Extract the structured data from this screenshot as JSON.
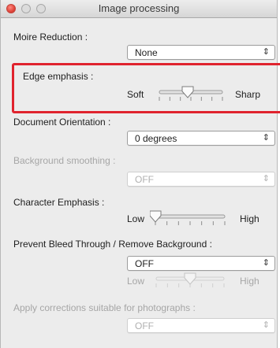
{
  "window": {
    "title": "Image processing"
  },
  "moire": {
    "label": "Moire Reduction :",
    "value": "None"
  },
  "edge": {
    "label": "Edge emphasis :",
    "min_label": "Soft",
    "max_label": "Sharp",
    "level": 0.45
  },
  "orientation": {
    "label": "Document Orientation :",
    "value": "0 degrees"
  },
  "background_smoothing": {
    "label": "Background smoothing :",
    "value": "OFF"
  },
  "character_emphasis": {
    "label": "Character Emphasis :",
    "min_label": "Low",
    "max_label": "High",
    "level": 0.0
  },
  "bleed": {
    "label": "Prevent Bleed Through / Remove Background :",
    "value": "OFF",
    "min_label": "Low",
    "max_label": "High",
    "level": 0.5
  },
  "photo": {
    "label": "Apply corrections suitable for photographs :",
    "value": "OFF"
  },
  "icons": {
    "dropdown": "updown-chevron-icon",
    "close": "close-button-icon"
  },
  "colors": {
    "highlight": "#e0232e",
    "close": "#e0443a"
  }
}
